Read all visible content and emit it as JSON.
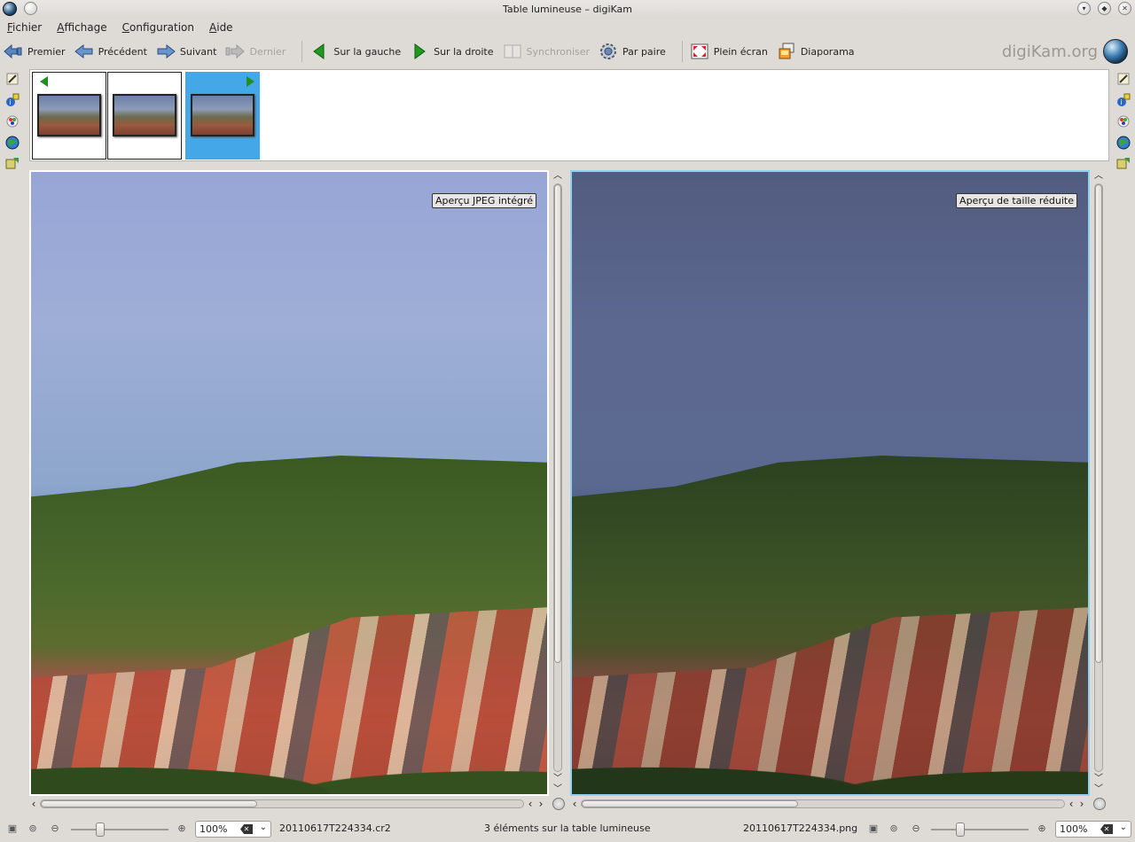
{
  "window": {
    "title": "Table lumineuse – digiKam"
  },
  "menu": [
    "Fichier",
    "Affichage",
    "Configuration",
    "Aide"
  ],
  "toolbar": {
    "first": "Premier",
    "previous": "Précédent",
    "next": "Suivant",
    "last": "Dernier",
    "on_left": "Sur la gauche",
    "on_right": "Sur la droite",
    "synchronize": "Synchroniser",
    "by_pair": "Par paire",
    "fullscreen": "Plein écran",
    "slideshow": "Diaporama"
  },
  "brand": "digiKam.org",
  "previews": {
    "left": {
      "label": "Aperçu JPEG intégré",
      "filename": "20110617T224334.cr2",
      "zoom": "100%"
    },
    "right": {
      "label": "Aperçu de taille réduite",
      "filename": "20110617T224334.png",
      "zoom": "100%"
    }
  },
  "status": {
    "count_text": "3 éléments sur la table lumineuse"
  },
  "colors": {
    "selection": "#44a8e8",
    "flag": "#1f8f1f",
    "right_pane_border": "#8fd2f0"
  }
}
